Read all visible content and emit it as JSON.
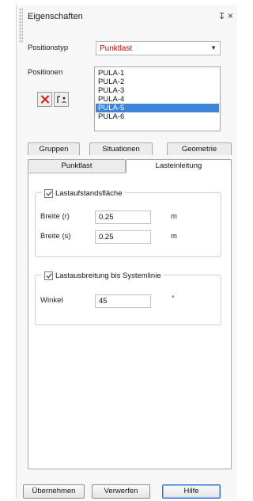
{
  "window": {
    "title": "Eigenschaften",
    "pin_glyph": "↧",
    "close_glyph": "×"
  },
  "position_type": {
    "label": "Positionstyp",
    "value": "Punktlast"
  },
  "positions": {
    "label": "Positionen",
    "items": [
      "PULA-1",
      "PULA-2",
      "PULA-3",
      "PULA-4",
      "PULA-5",
      "PULA-6"
    ],
    "selected_index": 4
  },
  "tabs": {
    "row1": [
      "Gruppen",
      "Situationen",
      "Geometrie"
    ],
    "row2": [
      "Punktlast",
      "Lasteinleitung"
    ],
    "active": "Lasteinleitung"
  },
  "load_area": {
    "checkbox_label": "Lastaufstandsfläche",
    "checked": true,
    "rows": [
      {
        "label": "Breite (r)",
        "value": "0.25",
        "unit": "m"
      },
      {
        "label": "Breite (s)",
        "value": "0.25",
        "unit": "m"
      }
    ]
  },
  "load_spread": {
    "checkbox_label": "Lastausbreitung bis Systemlinie",
    "checked": true,
    "angle_label": "Winkel",
    "angle_value": "45",
    "angle_unit": "°"
  },
  "buttons": {
    "apply": "Übernehmen",
    "discard": "Verwerfen",
    "help": "Hilfe"
  },
  "icons": {
    "delete": "delete-x-icon",
    "edit": "edit-positions-icon",
    "dropdown": "chevron-down-icon",
    "pin": "pin-icon",
    "close": "close-icon"
  },
  "colors": {
    "value_red": "#d40000",
    "selection_blue": "#3f84d8",
    "default_button_border": "#2f6fd0"
  }
}
